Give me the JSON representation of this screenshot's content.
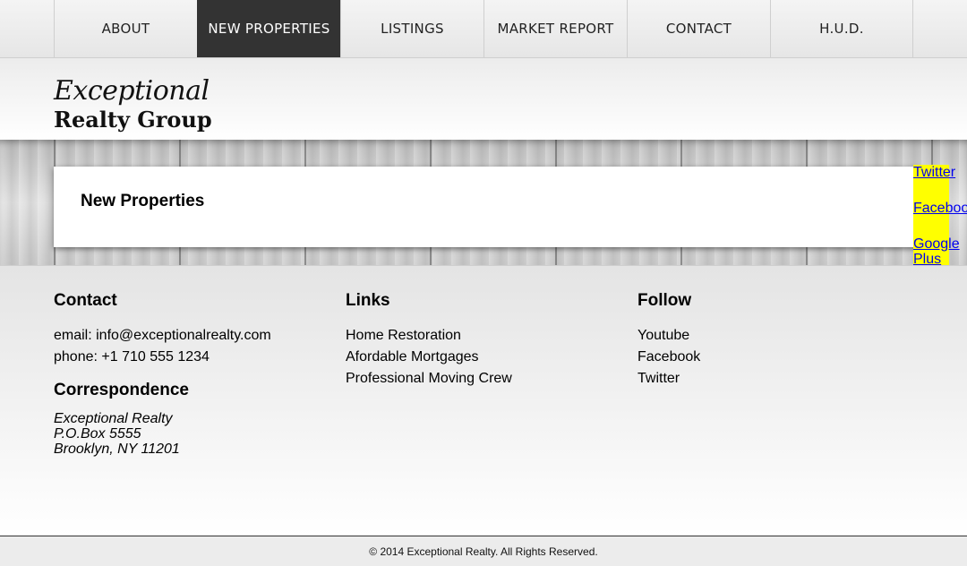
{
  "nav": {
    "items": [
      {
        "label": "ABOUT"
      },
      {
        "label": "NEW PROPERTIES",
        "active": true
      },
      {
        "label": "LISTINGS"
      },
      {
        "label": "MARKET REPORT"
      },
      {
        "label": "CONTACT"
      },
      {
        "label": "H.U.D."
      }
    ],
    "active_color": "#333333"
  },
  "logo": {
    "line1": "Exceptional",
    "line2": "Realty Group"
  },
  "content": {
    "title": "New Properties"
  },
  "social": {
    "highlight_color": "#ffff00",
    "links": [
      "Twitter",
      "Facebook",
      "Google Plus"
    ]
  },
  "footer": {
    "contact": {
      "heading": "Contact",
      "email": "email: info@exceptionalrealty.com",
      "phone": "phone: +1 710 555 1234"
    },
    "correspondence": {
      "heading": "Correspondence",
      "lines": [
        "Exceptional Realty",
        "P.O.Box 5555",
        "Brooklyn, NY 11201"
      ]
    },
    "links": {
      "heading": "Links",
      "items": [
        "Home Restoration",
        "Afordable Mortgages",
        "Professional Moving Crew"
      ]
    },
    "follow": {
      "heading": "Follow",
      "items": [
        "Youtube",
        "Facebook",
        "Twitter"
      ]
    }
  },
  "copyright": "© 2014 Exceptional Realty. All Rights Reserved."
}
